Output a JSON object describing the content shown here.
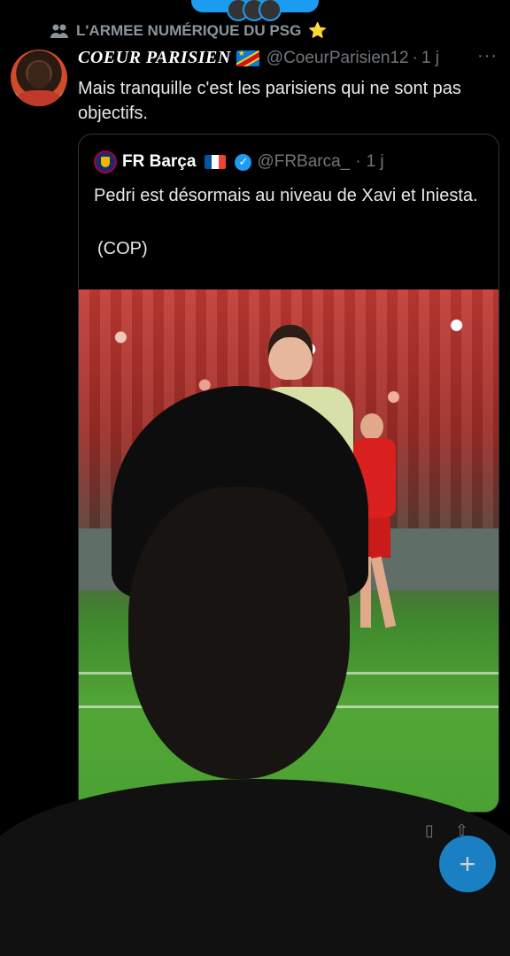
{
  "social_context": {
    "icon": "community-icon",
    "label": "L'ARMEE NUMÉRIQUE DU PSG",
    "badge": "⭐"
  },
  "tweet": {
    "display_name": "COEUR PARISIEN",
    "flag": "🇨🇩",
    "handle": "@CoeurParisien12",
    "separator": "·",
    "time": "1 j",
    "more": "···",
    "text": "Mais tranquille c'est les parisiens qui ne sont pas objectifs."
  },
  "quote": {
    "display_name": "FR Barça",
    "flag": "🇫🇷",
    "verified": "✓",
    "handle": "@FRBarca_",
    "separator": "·",
    "time": "1 j",
    "lines": [
      "Pedri est désormais au niveau de Xavi et Iniesta.",
      "(COP)"
    ]
  },
  "fab": {
    "label": "+"
  },
  "colors": {
    "accent": "#1d9bf0",
    "background": "#000000",
    "muted": "#71767b"
  }
}
